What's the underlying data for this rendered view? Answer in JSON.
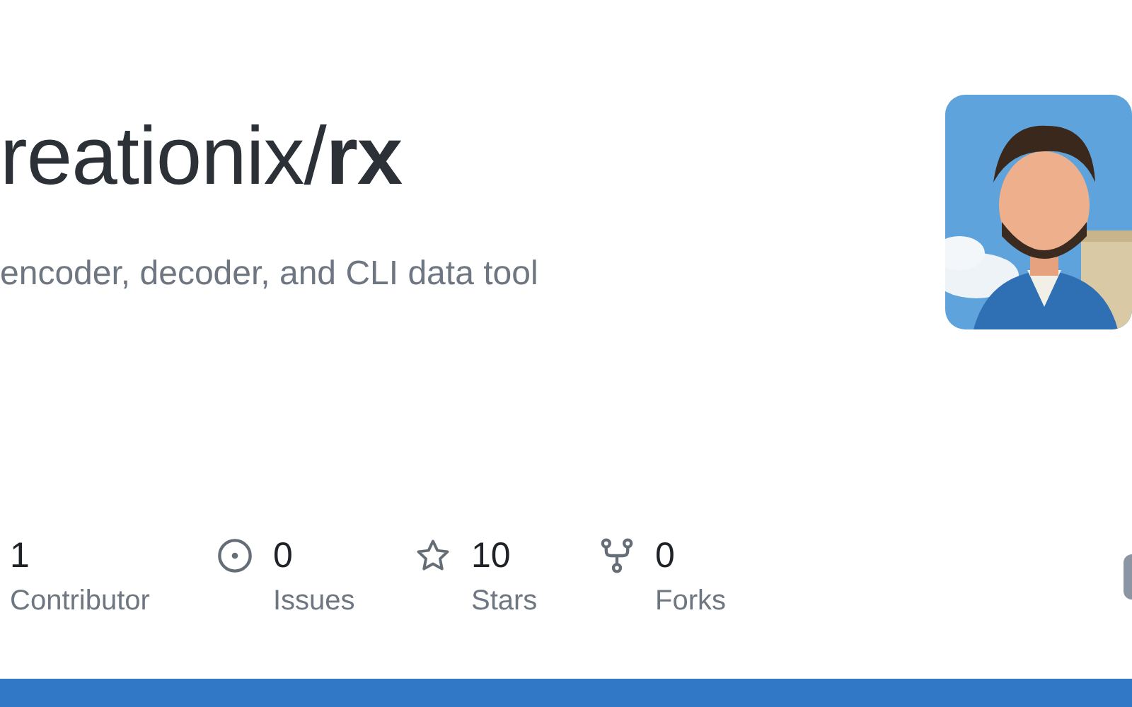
{
  "repo": {
    "title": "reationix/**rx**",
    "description": "encoder, decoder, and CLI data tool"
  },
  "stats": [
    {
      "kind": "contributors",
      "value": "1",
      "label": "Contributor"
    },
    {
      "kind": "issues",
      "value": "0",
      "label": "Issues"
    },
    {
      "kind": "stars",
      "value": "10",
      "label": "Stars"
    },
    {
      "kind": "forks",
      "value": "0",
      "label": "Forks"
    }
  ]
}
